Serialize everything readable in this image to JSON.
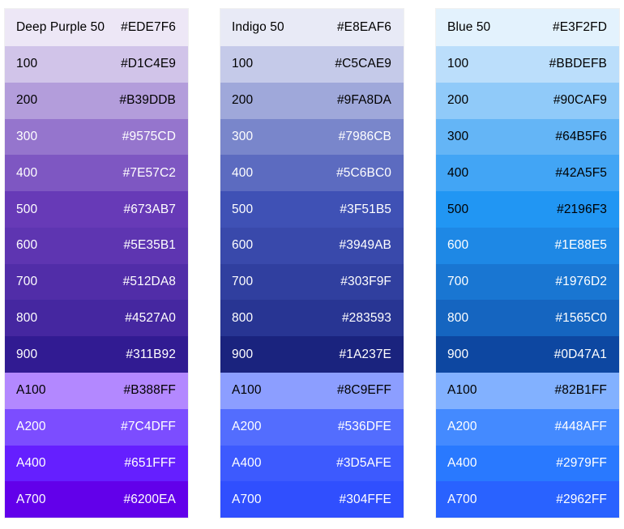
{
  "palettes": [
    {
      "header": {
        "name": "Deep Purple 50",
        "hex": "#EDE7F6",
        "text_color": "#000000"
      },
      "swatches": [
        {
          "name": "100",
          "hex": "#D1C4E9",
          "text_color": "#000000"
        },
        {
          "name": "200",
          "hex": "#B39DDB",
          "text_color": "#000000"
        },
        {
          "name": "300",
          "hex": "#9575CD",
          "text_color": "#ffffff"
        },
        {
          "name": "400",
          "hex": "#7E57C2",
          "text_color": "#ffffff"
        },
        {
          "name": "500",
          "hex": "#673AB7",
          "text_color": "#ffffff"
        },
        {
          "name": "600",
          "hex": "#5E35B1",
          "text_color": "#ffffff"
        },
        {
          "name": "700",
          "hex": "#512DA8",
          "text_color": "#ffffff"
        },
        {
          "name": "800",
          "hex": "#4527A0",
          "text_color": "#ffffff"
        },
        {
          "name": "900",
          "hex": "#311B92",
          "text_color": "#ffffff"
        },
        {
          "name": "A100",
          "hex": "#B388FF",
          "text_color": "#000000"
        },
        {
          "name": "A200",
          "hex": "#7C4DFF",
          "text_color": "#ffffff"
        },
        {
          "name": "A400",
          "hex": "#651FFF",
          "text_color": "#ffffff"
        },
        {
          "name": "A700",
          "hex": "#6200EA",
          "text_color": "#ffffff"
        }
      ]
    },
    {
      "header": {
        "name": "Indigo 50",
        "hex": "#E8EAF6",
        "text_color": "#000000"
      },
      "swatches": [
        {
          "name": "100",
          "hex": "#C5CAE9",
          "text_color": "#000000"
        },
        {
          "name": "200",
          "hex": "#9FA8DA",
          "text_color": "#000000"
        },
        {
          "name": "300",
          "hex": "#7986CB",
          "text_color": "#ffffff"
        },
        {
          "name": "400",
          "hex": "#5C6BC0",
          "text_color": "#ffffff"
        },
        {
          "name": "500",
          "hex": "#3F51B5",
          "text_color": "#ffffff"
        },
        {
          "name": "600",
          "hex": "#3949AB",
          "text_color": "#ffffff"
        },
        {
          "name": "700",
          "hex": "#303F9F",
          "text_color": "#ffffff"
        },
        {
          "name": "800",
          "hex": "#283593",
          "text_color": "#ffffff"
        },
        {
          "name": "900",
          "hex": "#1A237E",
          "text_color": "#ffffff"
        },
        {
          "name": "A100",
          "hex": "#8C9EFF",
          "text_color": "#000000"
        },
        {
          "name": "A200",
          "hex": "#536DFE",
          "text_color": "#ffffff"
        },
        {
          "name": "A400",
          "hex": "#3D5AFE",
          "text_color": "#ffffff"
        },
        {
          "name": "A700",
          "hex": "#304FFE",
          "text_color": "#ffffff"
        }
      ]
    },
    {
      "header": {
        "name": "Blue 50",
        "hex": "#E3F2FD",
        "text_color": "#000000"
      },
      "swatches": [
        {
          "name": "100",
          "hex": "#BBDEFB",
          "text_color": "#000000"
        },
        {
          "name": "200",
          "hex": "#90CAF9",
          "text_color": "#000000"
        },
        {
          "name": "300",
          "hex": "#64B5F6",
          "text_color": "#000000"
        },
        {
          "name": "400",
          "hex": "#42A5F5",
          "text_color": "#000000"
        },
        {
          "name": "500",
          "hex": "#2196F3",
          "text_color": "#000000"
        },
        {
          "name": "600",
          "hex": "#1E88E5",
          "text_color": "#ffffff"
        },
        {
          "name": "700",
          "hex": "#1976D2",
          "text_color": "#ffffff"
        },
        {
          "name": "800",
          "hex": "#1565C0",
          "text_color": "#ffffff"
        },
        {
          "name": "900",
          "hex": "#0D47A1",
          "text_color": "#ffffff"
        },
        {
          "name": "A100",
          "hex": "#82B1FF",
          "text_color": "#000000"
        },
        {
          "name": "A200",
          "hex": "#448AFF",
          "text_color": "#ffffff"
        },
        {
          "name": "A400",
          "hex": "#2979FF",
          "text_color": "#ffffff"
        },
        {
          "name": "A700",
          "hex": "#2962FF",
          "text_color": "#ffffff"
        }
      ]
    }
  ]
}
